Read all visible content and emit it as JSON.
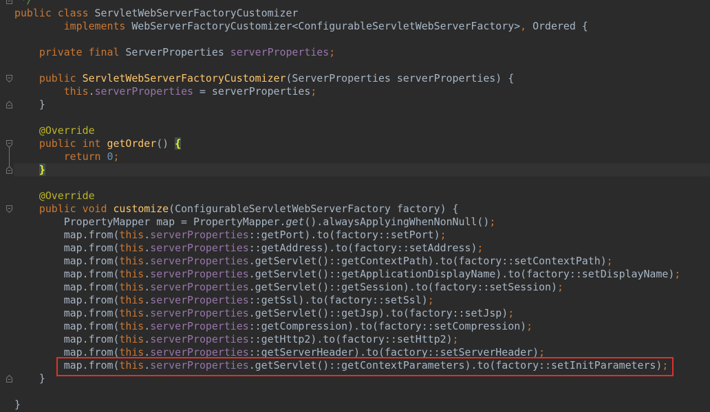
{
  "theme": {
    "background": "#2b2b2b",
    "text": "#a9b7c6",
    "caret_line": "#323232",
    "brace_match_fg": "#ffef28",
    "brace_match_bg": "#3b514d",
    "fold_marker": "#72767a",
    "annotation_box": "#e0312b"
  },
  "editor": {
    "lines": [
      {
        "fold_icon": "fold-end-icon",
        "tokens": [
          {
            "text": " */",
            "color": "#629755",
            "italic": true
          }
        ]
      },
      {
        "tokens": [
          {
            "text": "public class",
            "color": "#cc7832"
          },
          {
            "text": " ServletWebServerFactoryCustomizer"
          }
        ]
      },
      {
        "tokens": [
          {
            "text": "        implements",
            "color": "#cc7832"
          },
          {
            "text": " WebServerFactoryCustomizer<ConfigurableServletWebServerFactory>"
          },
          {
            "text": ",",
            "color": "#cc7832"
          },
          {
            "text": " Ordered {"
          }
        ]
      },
      {
        "tokens": []
      },
      {
        "tokens": [
          {
            "text": "    private final",
            "color": "#cc7832"
          },
          {
            "text": " ServerProperties "
          },
          {
            "text": "serverProperties",
            "color": "#9876aa"
          },
          {
            "text": ";",
            "color": "#cc7832"
          }
        ]
      },
      {
        "tokens": []
      },
      {
        "fold_icon": "fold-start-icon",
        "tokens": [
          {
            "text": "    public ",
            "color": "#cc7832"
          },
          {
            "text": "ServletWebServerFactoryCustomizer",
            "color": "#ffc66d"
          },
          {
            "text": "(ServerProperties serverProperties) {"
          }
        ]
      },
      {
        "tokens": [
          {
            "text": "        this",
            "color": "#cc7832"
          },
          {
            "text": "."
          },
          {
            "text": "serverProperties",
            "color": "#9876aa"
          },
          {
            "text": " = serverProperties"
          },
          {
            "text": ";",
            "color": "#cc7832"
          }
        ]
      },
      {
        "fold_icon": "fold-end-icon",
        "tokens": [
          {
            "text": "    }"
          }
        ]
      },
      {
        "tokens": []
      },
      {
        "tokens": [
          {
            "text": "    @Override",
            "color": "#bbb529"
          }
        ]
      },
      {
        "fold_icon": "fold-start-icon",
        "caret_scope": true,
        "tokens": [
          {
            "text": "    public int ",
            "color": "#cc7832"
          },
          {
            "text": "getOrder",
            "color": "#ffc66d"
          },
          {
            "text": "() "
          },
          {
            "text": "{",
            "brace_match": true
          }
        ]
      },
      {
        "caret_scope": true,
        "tokens": [
          {
            "text": "        return ",
            "color": "#cc7832"
          },
          {
            "text": "0",
            "color": "#6897bb"
          },
          {
            "text": ";",
            "color": "#cc7832"
          }
        ]
      },
      {
        "fold_icon": "fold-end-icon",
        "caret_scope": true,
        "caret_line": true,
        "tokens": [
          {
            "text": "    "
          },
          {
            "text": "}",
            "brace_match": true
          }
        ]
      },
      {
        "tokens": []
      },
      {
        "tokens": [
          {
            "text": "    @Override",
            "color": "#bbb529"
          }
        ]
      },
      {
        "fold_icon": "fold-start-icon",
        "tokens": [
          {
            "text": "    public void ",
            "color": "#cc7832"
          },
          {
            "text": "customize",
            "color": "#ffc66d"
          },
          {
            "text": "(ConfigurableServletWebServerFactory factory) {"
          }
        ]
      },
      {
        "tokens": [
          {
            "text": "        PropertyMapper map = PropertyMapper."
          },
          {
            "text": "get",
            "italic": true
          },
          {
            "text": "().alwaysApplyingWhenNonNull()"
          },
          {
            "text": ";",
            "color": "#cc7832"
          }
        ]
      },
      {
        "tokens": [
          {
            "text": "        map.from("
          },
          {
            "text": "this",
            "color": "#cc7832"
          },
          {
            "text": "."
          },
          {
            "text": "serverProperties",
            "color": "#9876aa"
          },
          {
            "text": "::getPort).to(factory::setPort)"
          },
          {
            "text": ";",
            "color": "#cc7832"
          }
        ]
      },
      {
        "tokens": [
          {
            "text": "        map.from("
          },
          {
            "text": "this",
            "color": "#cc7832"
          },
          {
            "text": "."
          },
          {
            "text": "serverProperties",
            "color": "#9876aa"
          },
          {
            "text": "::getAddress).to(factory::setAddress)"
          },
          {
            "text": ";",
            "color": "#cc7832"
          }
        ]
      },
      {
        "tokens": [
          {
            "text": "        map.from("
          },
          {
            "text": "this",
            "color": "#cc7832"
          },
          {
            "text": "."
          },
          {
            "text": "serverProperties",
            "color": "#9876aa"
          },
          {
            "text": ".getServlet()::getContextPath).to(factory::setContextPath)"
          },
          {
            "text": ";",
            "color": "#cc7832"
          }
        ]
      },
      {
        "tokens": [
          {
            "text": "        map.from("
          },
          {
            "text": "this",
            "color": "#cc7832"
          },
          {
            "text": "."
          },
          {
            "text": "serverProperties",
            "color": "#9876aa"
          },
          {
            "text": ".getServlet()::getApplicationDisplayName).to(factory::setDisplayName)"
          },
          {
            "text": ";",
            "color": "#cc7832"
          }
        ]
      },
      {
        "tokens": [
          {
            "text": "        map.from("
          },
          {
            "text": "this",
            "color": "#cc7832"
          },
          {
            "text": "."
          },
          {
            "text": "serverProperties",
            "color": "#9876aa"
          },
          {
            "text": ".getServlet()::getSession).to(factory::setSession)"
          },
          {
            "text": ";",
            "color": "#cc7832"
          }
        ]
      },
      {
        "tokens": [
          {
            "text": "        map.from("
          },
          {
            "text": "this",
            "color": "#cc7832"
          },
          {
            "text": "."
          },
          {
            "text": "serverProperties",
            "color": "#9876aa"
          },
          {
            "text": "::getSsl).to(factory::setSsl)"
          },
          {
            "text": ";",
            "color": "#cc7832"
          }
        ]
      },
      {
        "tokens": [
          {
            "text": "        map.from("
          },
          {
            "text": "this",
            "color": "#cc7832"
          },
          {
            "text": "."
          },
          {
            "text": "serverProperties",
            "color": "#9876aa"
          },
          {
            "text": ".getServlet()::getJsp).to(factory::setJsp)"
          },
          {
            "text": ";",
            "color": "#cc7832"
          }
        ]
      },
      {
        "tokens": [
          {
            "text": "        map.from("
          },
          {
            "text": "this",
            "color": "#cc7832"
          },
          {
            "text": "."
          },
          {
            "text": "serverProperties",
            "color": "#9876aa"
          },
          {
            "text": "::getCompression).to(factory::setCompression)"
          },
          {
            "text": ";",
            "color": "#cc7832"
          }
        ]
      },
      {
        "tokens": [
          {
            "text": "        map.from("
          },
          {
            "text": "this",
            "color": "#cc7832"
          },
          {
            "text": "."
          },
          {
            "text": "serverProperties",
            "color": "#9876aa"
          },
          {
            "text": "::getHttp2).to(factory::setHttp2)"
          },
          {
            "text": ";",
            "color": "#cc7832"
          }
        ]
      },
      {
        "tokens": [
          {
            "text": "        map.from("
          },
          {
            "text": "this",
            "color": "#cc7832"
          },
          {
            "text": "."
          },
          {
            "text": "serverProperties",
            "color": "#9876aa"
          },
          {
            "text": "::getServerHeader).to(factory::setServerHeader)"
          },
          {
            "text": ";",
            "color": "#cc7832"
          }
        ]
      },
      {
        "tokens": [
          {
            "text": "        map.from("
          },
          {
            "text": "this",
            "color": "#cc7832"
          },
          {
            "text": "."
          },
          {
            "text": "serverProperties",
            "color": "#9876aa"
          },
          {
            "text": ".getServlet()::getContextParameters).to(factory::setInitParameters)"
          },
          {
            "text": ";",
            "color": "#cc7832"
          }
        ]
      },
      {
        "fold_icon": "fold-end-icon",
        "tokens": [
          {
            "text": "    }"
          }
        ]
      },
      {
        "tokens": []
      },
      {
        "tokens": [
          {
            "text": "}"
          }
        ]
      }
    ]
  }
}
